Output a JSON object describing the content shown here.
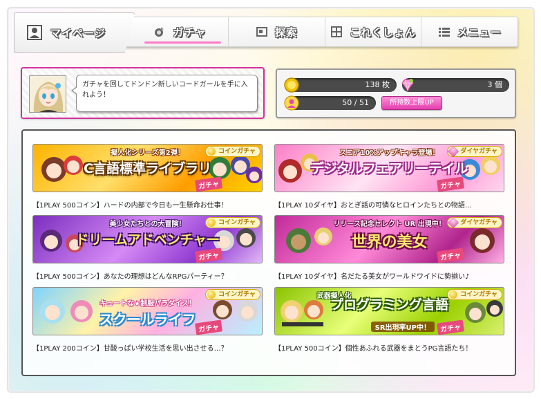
{
  "nav": {
    "mypage_label": "マイページ",
    "tabs": [
      {
        "label": "ガチャ",
        "icon": "gacha-icon",
        "active": true
      },
      {
        "label": "探索",
        "icon": "explore-icon",
        "active": false
      },
      {
        "label": "これくしょん",
        "icon": "collection-icon",
        "active": false
      },
      {
        "label": "メニュー",
        "icon": "menu-icon",
        "active": false
      }
    ]
  },
  "message": {
    "text": "ガチャを回してドンドン新しいコードガールを手に入れよう！"
  },
  "status": {
    "coins": "138 枚",
    "diamonds": "3 個",
    "capacity": "50 / 51",
    "upgrade_button": "所持数上限UP"
  },
  "gacha": [
    {
      "title": "C言語標準ライブラリ",
      "subtitle": "擬人化シリーズ第2弾！",
      "badge": "コインガチャ",
      "tag": "ガチャ",
      "caption": "【1PLAY 500コイン】ハードの内部で今日も一生懸命お仕事！"
    },
    {
      "title": "デジタルフェアリーテイル",
      "subtitle": "スコア10%アップキャラ登場！",
      "badge": "ダイヤガチャ",
      "tag": "ガチャ",
      "caption": "【1PLAY 10ダイヤ】おとぎ話の可憐なヒロインたちとの物語…"
    },
    {
      "title": "ドリームアドベンチャー",
      "subtitle": "美少女たちとの大冒険！",
      "badge": "コインガチャ",
      "tag": "ガチャ",
      "caption": "【1PLAY 500コイン】あなたの理想はどんなRPGパーティー？"
    },
    {
      "title": "世界の美女",
      "subtitle": "リリース記念セレクト UR 出現中！",
      "badge": "ダイヤガチャ",
      "tag": "ガチャ",
      "caption": "【1PLAY 10ダイヤ】名だたる美女がワールドワイドに勢揃い♪"
    },
    {
      "title": "スクールライフ",
      "subtitle": "キュートな★制服パラダイス！",
      "badge": "コインガチャ",
      "tag": "ガチャ",
      "caption": "【1PLAY 200コイン】甘酸っぱい学校生活を思い出させる…？"
    },
    {
      "title": "プログラミング言語",
      "subtitle": "武器擬人化",
      "extra": "SR出現率UP中！",
      "badge": "コインガチャ",
      "tag": "ガチャ",
      "caption": "【1PLAY 500コイン】個性あふれる武器をまとうPG言語たち！"
    }
  ],
  "colors": {
    "accent": "#e43fae",
    "frame_border": "#d62ea0"
  }
}
